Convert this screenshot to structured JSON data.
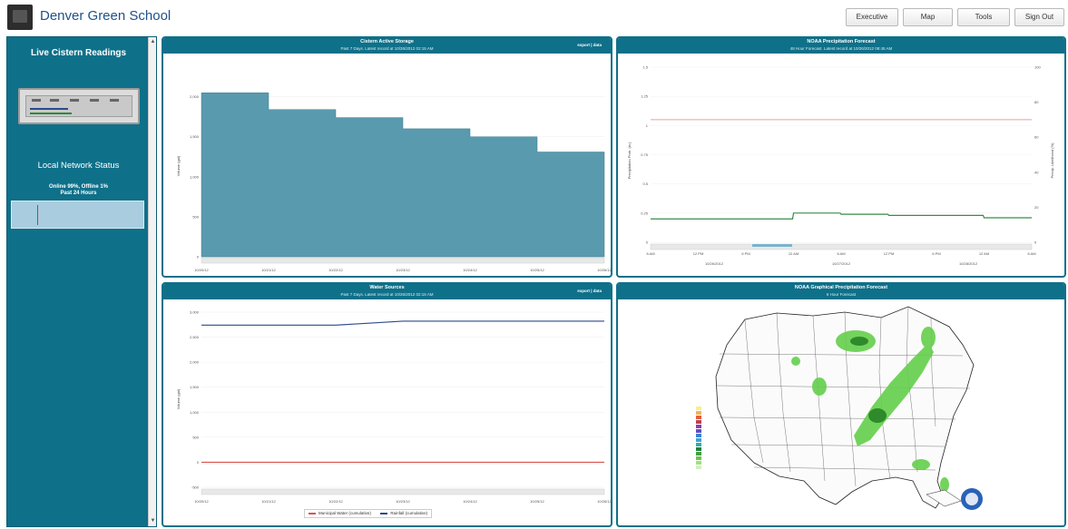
{
  "header": {
    "school_name": "Denver Green School",
    "nav": [
      {
        "label": "Executive"
      },
      {
        "label": "Map"
      },
      {
        "label": "Tools"
      },
      {
        "label": "Sign Out"
      }
    ]
  },
  "sidebar": {
    "title": "Live Cistern Readings",
    "network_title": "Local Network Status",
    "network_status_line1": "Online 99%, Offline 1%",
    "network_status_line2": "Past 24 Hours"
  },
  "panels": {
    "storage": {
      "title": "Cistern Active Storage",
      "subtitle": "Past 7 Days. Latest record at 10/26/2012 02:15 AM",
      "export": "export | data",
      "ylabel": "Volume (gal)",
      "chart_data": {
        "type": "area",
        "x": [
          "10/20/12",
          "10/21/12",
          "10/22/12",
          "10/23/12",
          "10/24/12",
          "10/25/12",
          "10/26/12"
        ],
        "y_ticks": [
          0,
          500,
          1000,
          1500,
          2000
        ],
        "ylim": [
          0,
          2200
        ],
        "series": [
          {
            "values": [
              2050,
              1840,
              1740,
              1600,
              1500,
              1310,
              1100
            ]
          }
        ]
      }
    },
    "precip": {
      "title": "NOAA Precipitation Forecast",
      "subtitle": "48 Hour Forecast. Latest record at 10/26/2012 08:45 AM",
      "ylabel_left": "Precipitation Prob. (in.)",
      "ylabel_right": "Precip. Likelihood (%)",
      "chart_data": {
        "type": "line",
        "x": [
          "6 AM",
          "12 PM",
          "6 PM",
          "12 AM",
          "6 AM",
          "12 PM",
          "6 PM",
          "12 AM",
          "6 AM"
        ],
        "date_labels": [
          "10/26/2012",
          "10/27/2012",
          "10/28/2012"
        ],
        "y_ticks_left": [
          0,
          0.25,
          0.5,
          0.75,
          1,
          1.25,
          1.5
        ],
        "y_ticks_right": [
          0,
          20,
          40,
          60,
          80,
          100
        ],
        "series": [
          {
            "values": [
              1.05,
              1.05,
              1.05,
              1.05,
              1.05,
              1.05,
              1.05,
              1.05,
              1.05
            ]
          },
          {
            "values": [
              0.2,
              0.2,
              0.2,
              0.25,
              0.24,
              0.23,
              0.23,
              0.21,
              0.21
            ]
          }
        ]
      }
    },
    "sources": {
      "title": "Water Sources",
      "subtitle": "Past 7 Days. Latest record at 10/26/2012 02:15 AM",
      "export": "export | data",
      "ylabel": "Volume (gal)",
      "chart_data": {
        "type": "line",
        "x": [
          "10/20/12",
          "10/21/12",
          "10/22/12",
          "10/23/12",
          "10/24/12",
          "10/25/12",
          "10/26/12"
        ],
        "y_ticks": [
          -500,
          0,
          500,
          1000,
          1500,
          2000,
          2500,
          3000
        ],
        "ylim": [
          -500,
          3000
        ],
        "series": [
          {
            "name": "Municipal Water (cumulative)",
            "color": "#d9534f",
            "values": [
              0,
              0,
              0,
              0,
              0,
              0,
              0
            ]
          },
          {
            "name": "Rainfall (cumulative)",
            "color": "#2c4a8c",
            "values": [
              2740,
              2740,
              2740,
              2820,
              2820,
              2820,
              2820
            ]
          }
        ]
      }
    },
    "map": {
      "title": "NOAA Graphical Precipitation Forecast",
      "subtitle": "6 Hour Forecast"
    }
  }
}
